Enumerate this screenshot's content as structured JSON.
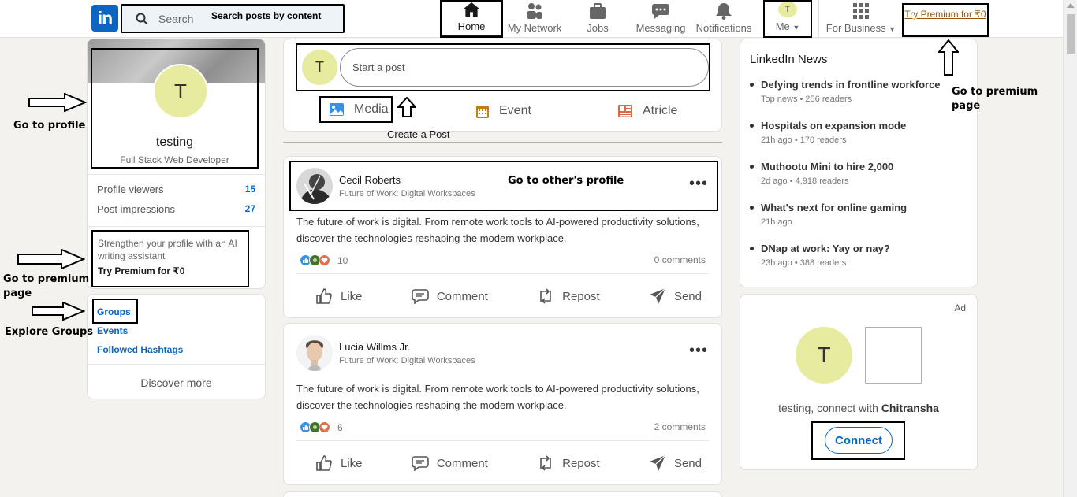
{
  "search": {
    "placeholder": "Search",
    "annotation": "Search posts by content"
  },
  "nav": {
    "home": "Home",
    "network": "My Network",
    "jobs": "Jobs",
    "messaging": "Messaging",
    "notifications": "Notifications",
    "me": "Me",
    "me_initial": "T",
    "business": "For Business",
    "premium": "Try Premium for ₹0"
  },
  "profile": {
    "initial": "T",
    "name": "testing",
    "headline": "Full Stack Web Developer",
    "viewers_label": "Profile viewers",
    "viewers": "15",
    "impressions_label": "Post impressions",
    "impressions": "27",
    "premium_text": "Strengthen your profile with an AI writing assistant",
    "premium_cta": "Try Premium for ₹0"
  },
  "sidebar_links": {
    "groups": "Groups",
    "events": "Events",
    "hashtags": "Followed Hashtags",
    "discover": "Discover more"
  },
  "annotations": {
    "profile": "Go to profile",
    "premium": "Go to premium page",
    "groups": "Explore Groups",
    "create_post": "Create a Post",
    "other_profile": "Go to other's profile",
    "premium_right": "Go to premium page"
  },
  "share": {
    "initial": "T",
    "placeholder": "Start a post",
    "media": "Media",
    "event": "Event",
    "article": "Atricle"
  },
  "posts": [
    {
      "author": "Cecil Roberts",
      "subtitle": "Future of Work: Digital Workspaces",
      "text": "The future of work is digital. From remote work tools to AI-powered productivity solutions, discover the technologies reshaping the modern workplace.",
      "reactions": "10",
      "comments": "0 comments"
    },
    {
      "author": "Lucia Willms Jr.",
      "subtitle": "Future of Work: Digital Workspaces",
      "text": "The future of work is digital. From remote work tools to AI-powered productivity solutions, discover the technologies reshaping the modern workplace.",
      "reactions": "6",
      "comments": "2 comments"
    }
  ],
  "post_actions": {
    "like": "Like",
    "comment": "Comment",
    "repost": "Repost",
    "send": "Send"
  },
  "news": {
    "title": "LinkedIn News",
    "items": [
      {
        "headline": "Defying trends in frontline workforce",
        "meta": "Top news • 256 readers"
      },
      {
        "headline": "Hospitals on expansion mode",
        "meta": "21h ago • 170 readers"
      },
      {
        "headline": "Muthootu Mini to hire 2,000",
        "meta": "2d ago • 4,918 readers"
      },
      {
        "headline": "What's next for online gaming",
        "meta": "21h ago"
      },
      {
        "headline": "DNap at work: Yay or nay?",
        "meta": "23h ago • 388 readers"
      }
    ]
  },
  "ad": {
    "label": "Ad",
    "initial": "T",
    "text_prefix": "testing, connect with",
    "name": "Chitransha",
    "connect": "Connect"
  },
  "colors": {
    "brand": "#0a66c2",
    "avatar": "#e7eb9f",
    "premium": "#915907"
  }
}
